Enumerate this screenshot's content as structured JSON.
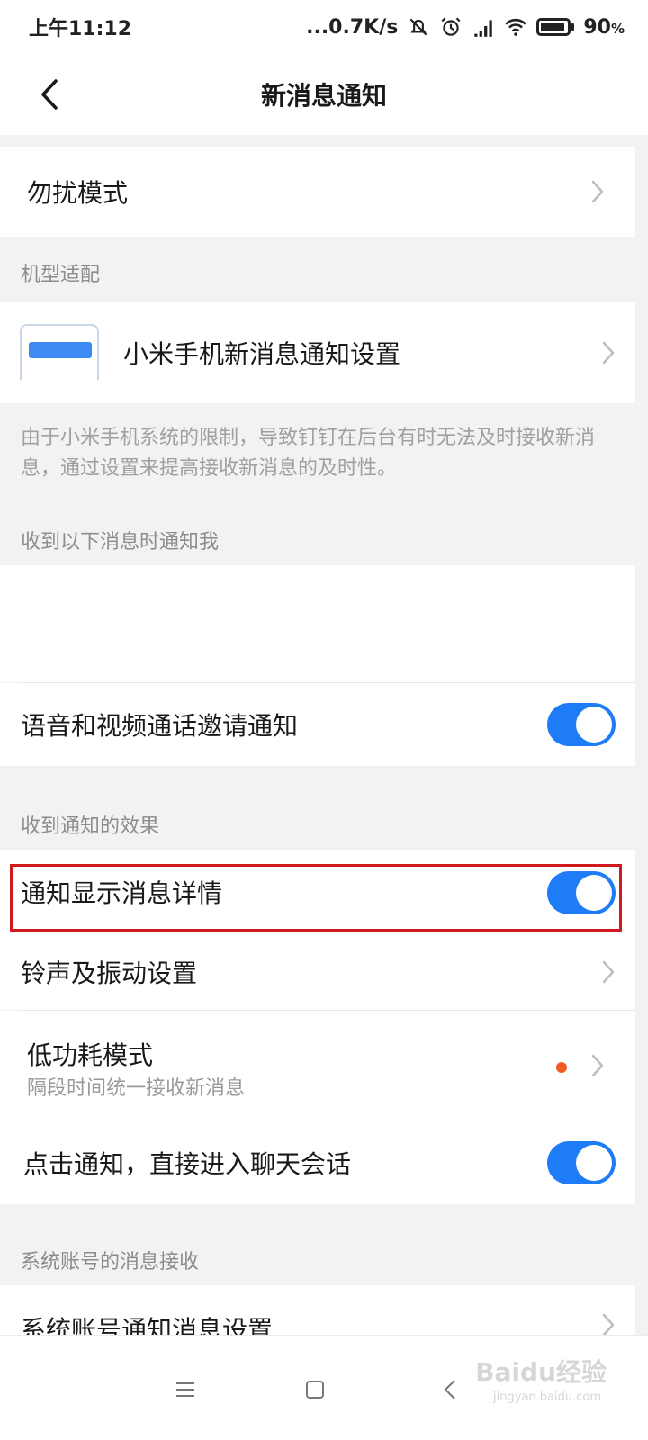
{
  "status_bar": {
    "time": "上午11:12",
    "network_speed": "...0.7K/s",
    "battery": "90",
    "battery_unit": "%",
    "battery_level": 0.9
  },
  "header": {
    "title": "新消息通知",
    "back_icon": "chevron-left-icon"
  },
  "rows": {
    "dnd": "勿扰模式",
    "group_device": "机型适配",
    "xiaomi": "小米手机新消息通知设置",
    "xiaomi_desc": "由于小米手机系统的限制，导致钉钉在后台有时无法及时接收新消息，通过设置来提高接收新消息的及时性。",
    "group_notify_me": "收到以下消息时通知我",
    "voice_video": "语音和视频通话邀请通知",
    "group_effect": "收到通知的效果",
    "show_details": "通知显示消息详情",
    "ringtone": "铃声及振动设置",
    "low_power": "低功耗模式",
    "low_power_sub": "隔段时间统一接收新消息",
    "tap_notify": "点击通知，直接进入聊天会话",
    "group_system": "系统账号的消息接收",
    "system_settings": "系统账号通知消息设置"
  },
  "toggles": {
    "voice_video": true,
    "show_details": true,
    "tap_notify": true
  },
  "colors": {
    "toggle_on": "#1f7cf7",
    "highlight": "#d0191c",
    "badge_dot": "#f25a1f"
  },
  "watermark": {
    "brand": "Baidu经验",
    "url": "jingyan.baidu.com"
  }
}
